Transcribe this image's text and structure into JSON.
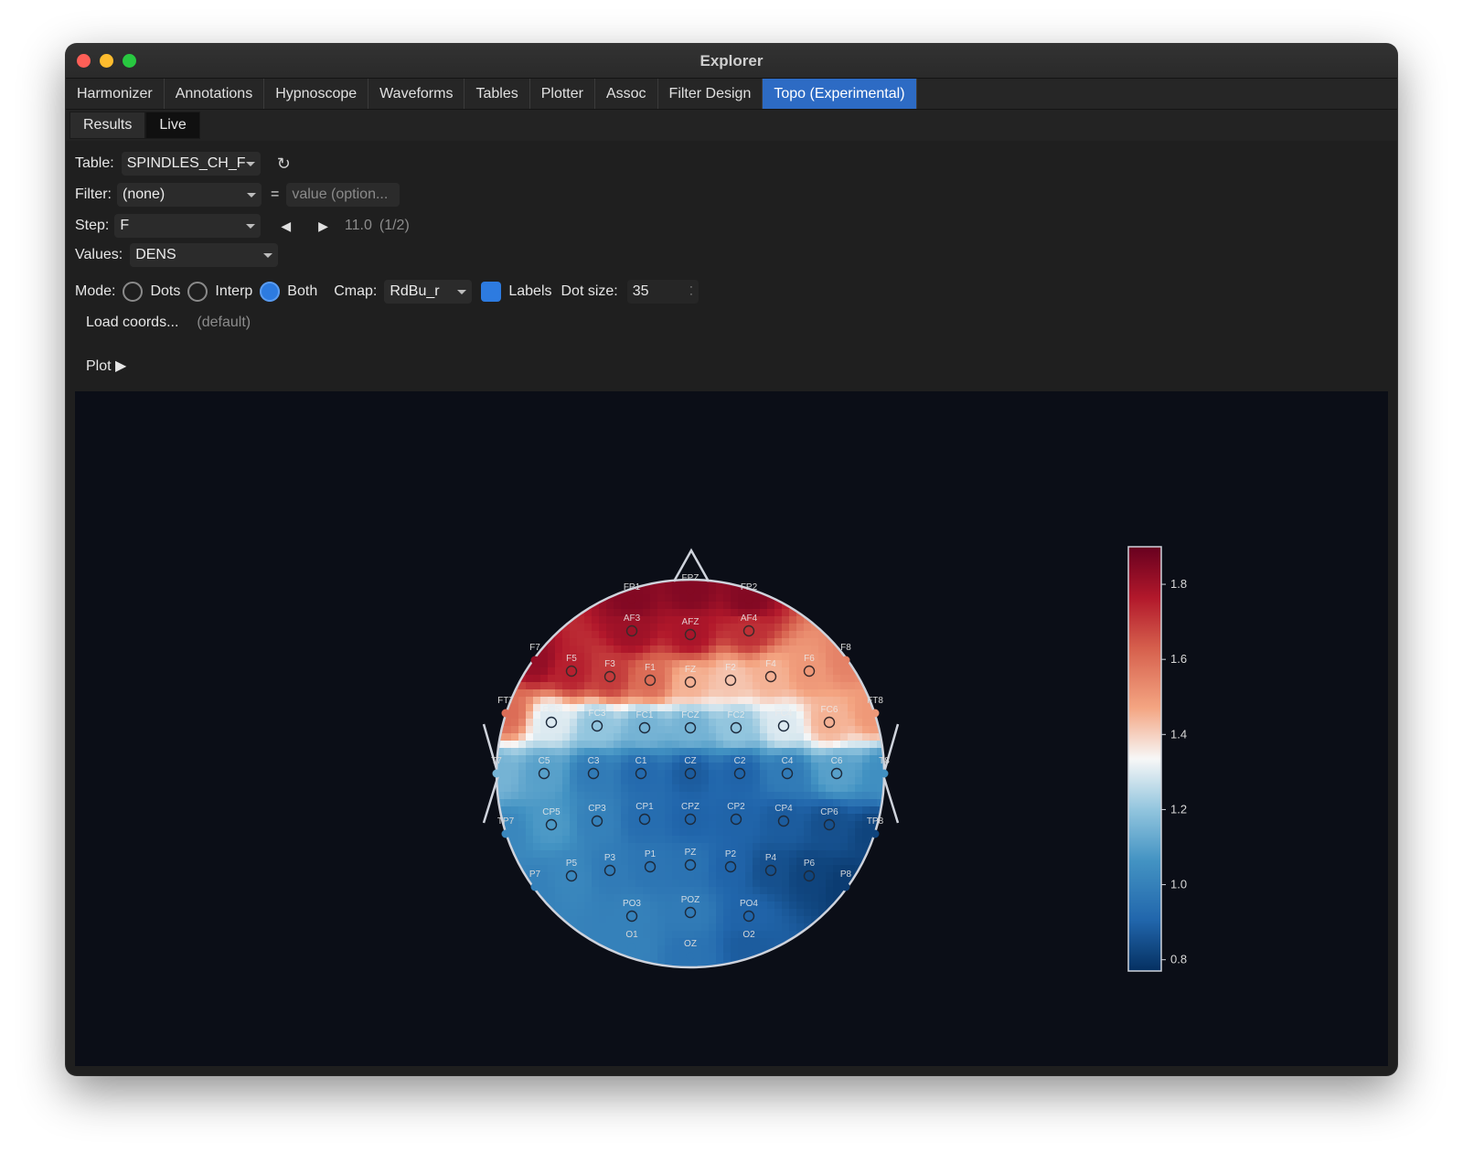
{
  "window": {
    "title": "Explorer"
  },
  "tabs": [
    {
      "label": "Harmonizer"
    },
    {
      "label": "Annotations"
    },
    {
      "label": "Hypnoscope"
    },
    {
      "label": "Waveforms"
    },
    {
      "label": "Tables"
    },
    {
      "label": "Plotter"
    },
    {
      "label": "Assoc"
    },
    {
      "label": "Filter Design"
    },
    {
      "label": "Topo (Experimental)",
      "active": true
    }
  ],
  "subtabs": [
    {
      "label": "Results"
    },
    {
      "label": "Live",
      "active": true
    }
  ],
  "controls": {
    "table_label": "Table:",
    "table_value": "SPINDLES_CH_F",
    "refresh_icon": "refresh-icon",
    "filter_label": "Filter:",
    "filter_value": "(none)",
    "equals": "=",
    "filter_placeholder": "value (option...",
    "step_label": "Step:",
    "step_value": "F",
    "step_readout": "11.0",
    "step_position": "(1/2)",
    "values_label": "Values:",
    "values_value": "DENS",
    "mode_label": "Mode:",
    "mode_options": [
      "Dots",
      "Interp",
      "Both"
    ],
    "mode_selected": "Both",
    "cmap_label": "Cmap:",
    "cmap_value": "RdBu_r",
    "labels_label": "Labels",
    "labels_checked": true,
    "dotsize_label": "Dot size:",
    "dotsize_value": "35",
    "load_coords_label": "Load coords...",
    "coords_status": "(default)",
    "plot_label": "Plot ▶"
  },
  "colors": {
    "accent": "#2d6bc4",
    "plot_bg": "#0b0e17",
    "cmap_low": "#053061",
    "cmap_mid": "#f7f7f7",
    "cmap_high": "#67001f"
  },
  "chart_data": {
    "type": "heatmap",
    "colormap": "RdBu_r",
    "colorbar": {
      "ticks": [
        0.8,
        1.0,
        1.2,
        1.4,
        1.6,
        1.8
      ],
      "tick_labels": [
        "0.8",
        "1.0",
        "1.2",
        "1.4",
        "1.6",
        "1.8"
      ],
      "range": [
        0.77,
        1.9
      ]
    },
    "channels": [
      {
        "label": "FP1",
        "x": -0.32,
        "y": 0.95,
        "value": 1.85,
        "outer": true
      },
      {
        "label": "FPZ",
        "x": 0.0,
        "y": 1.0,
        "value": 1.85,
        "outer": true
      },
      {
        "label": "FP2",
        "x": 0.32,
        "y": 0.95,
        "value": 1.85,
        "outer": true
      },
      {
        "label": "AF3",
        "x": -0.32,
        "y": 0.78,
        "value": 1.8
      },
      {
        "label": "AFZ",
        "x": 0.0,
        "y": 0.76,
        "value": 1.78
      },
      {
        "label": "AF4",
        "x": 0.32,
        "y": 0.78,
        "value": 1.72
      },
      {
        "label": "F7",
        "x": -0.85,
        "y": 0.62,
        "value": 1.82,
        "outer": true
      },
      {
        "label": "F5",
        "x": -0.65,
        "y": 0.56,
        "value": 1.75
      },
      {
        "label": "F3",
        "x": -0.44,
        "y": 0.53,
        "value": 1.7
      },
      {
        "label": "F1",
        "x": -0.22,
        "y": 0.51,
        "value": 1.6
      },
      {
        "label": "FZ",
        "x": 0.0,
        "y": 0.5,
        "value": 1.45
      },
      {
        "label": "F2",
        "x": 0.22,
        "y": 0.51,
        "value": 1.42
      },
      {
        "label": "F4",
        "x": 0.44,
        "y": 0.53,
        "value": 1.45
      },
      {
        "label": "F6",
        "x": 0.65,
        "y": 0.56,
        "value": 1.5
      },
      {
        "label": "F8",
        "x": 0.85,
        "y": 0.62,
        "value": 1.55,
        "outer": true
      },
      {
        "label": "FT7",
        "x": -1.01,
        "y": 0.33,
        "value": 1.6,
        "outer": true
      },
      {
        "label": "FC5",
        "x": -0.76,
        "y": 0.28,
        "value": 1.3
      },
      {
        "label": "FC3",
        "x": -0.51,
        "y": 0.26,
        "value": 1.2
      },
      {
        "label": "FC1",
        "x": -0.25,
        "y": 0.25,
        "value": 1.15
      },
      {
        "label": "FCZ",
        "x": 0.0,
        "y": 0.25,
        "value": 1.15
      },
      {
        "label": "FC2",
        "x": 0.25,
        "y": 0.25,
        "value": 1.2
      },
      {
        "label": "FC4",
        "x": 0.51,
        "y": 0.26,
        "value": 1.3
      },
      {
        "label": "FC6",
        "x": 0.76,
        "y": 0.28,
        "value": 1.45
      },
      {
        "label": "FT8",
        "x": 1.01,
        "y": 0.33,
        "value": 1.5,
        "outer": true
      },
      {
        "label": "T7",
        "x": -1.06,
        "y": 0.0,
        "value": 1.15,
        "outer": true
      },
      {
        "label": "C5",
        "x": -0.8,
        "y": 0.0,
        "value": 1.1
      },
      {
        "label": "C3",
        "x": -0.53,
        "y": 0.0,
        "value": 0.98
      },
      {
        "label": "C1",
        "x": -0.27,
        "y": 0.0,
        "value": 0.92
      },
      {
        "label": "CZ",
        "x": 0.0,
        "y": 0.0,
        "value": 0.88
      },
      {
        "label": "C2",
        "x": 0.27,
        "y": 0.0,
        "value": 0.9
      },
      {
        "label": "C4",
        "x": 0.53,
        "y": 0.0,
        "value": 0.98
      },
      {
        "label": "C6",
        "x": 0.8,
        "y": 0.0,
        "value": 1.1
      },
      {
        "label": "T8",
        "x": 1.06,
        "y": 0.0,
        "value": 1.05,
        "outer": true
      },
      {
        "label": "TP7",
        "x": -1.01,
        "y": -0.33,
        "value": 1.02,
        "outer": true
      },
      {
        "label": "CP5",
        "x": -0.76,
        "y": -0.28,
        "value": 1.08
      },
      {
        "label": "CP3",
        "x": -0.51,
        "y": -0.26,
        "value": 1.0
      },
      {
        "label": "CP1",
        "x": -0.25,
        "y": -0.25,
        "value": 0.93
      },
      {
        "label": "CPZ",
        "x": 0.0,
        "y": -0.25,
        "value": 0.9
      },
      {
        "label": "CP2",
        "x": 0.25,
        "y": -0.25,
        "value": 0.9
      },
      {
        "label": "CP4",
        "x": 0.51,
        "y": -0.26,
        "value": 0.88
      },
      {
        "label": "CP6",
        "x": 0.76,
        "y": -0.28,
        "value": 0.85
      },
      {
        "label": "TP8",
        "x": 1.01,
        "y": -0.33,
        "value": 0.82,
        "outer": true
      },
      {
        "label": "P7",
        "x": -0.85,
        "y": -0.62,
        "value": 1.0,
        "outer": true
      },
      {
        "label": "P5",
        "x": -0.65,
        "y": -0.56,
        "value": 1.02
      },
      {
        "label": "P3",
        "x": -0.44,
        "y": -0.53,
        "value": 0.98
      },
      {
        "label": "P1",
        "x": -0.22,
        "y": -0.51,
        "value": 0.96
      },
      {
        "label": "PZ",
        "x": 0.0,
        "y": -0.5,
        "value": 0.95
      },
      {
        "label": "P2",
        "x": 0.22,
        "y": -0.51,
        "value": 0.9
      },
      {
        "label": "P4",
        "x": 0.44,
        "y": -0.53,
        "value": 0.85
      },
      {
        "label": "P6",
        "x": 0.65,
        "y": -0.56,
        "value": 0.82
      },
      {
        "label": "P8",
        "x": 0.85,
        "y": -0.62,
        "value": 0.8,
        "outer": true
      },
      {
        "label": "PO3",
        "x": -0.32,
        "y": -0.78,
        "value": 1.0
      },
      {
        "label": "POZ",
        "x": 0.0,
        "y": -0.76,
        "value": 0.98
      },
      {
        "label": "PO4",
        "x": 0.32,
        "y": -0.78,
        "value": 0.9
      },
      {
        "label": "O1",
        "x": -0.32,
        "y": -0.95,
        "value": 1.0,
        "outer": true
      },
      {
        "label": "OZ",
        "x": 0.0,
        "y": -1.0,
        "value": 0.95,
        "outer": true
      },
      {
        "label": "O2",
        "x": 0.32,
        "y": -0.95,
        "value": 0.88,
        "outer": true
      }
    ]
  }
}
